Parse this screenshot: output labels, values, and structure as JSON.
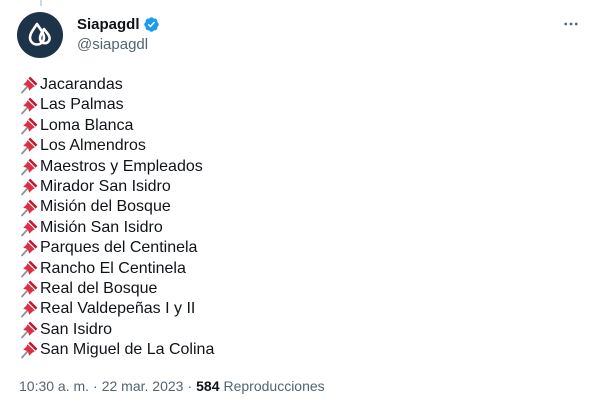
{
  "tweet": {
    "author": {
      "display_name": "Siapagdl",
      "handle": "@siapagdl",
      "avatar_icon": "water-drops-logo",
      "avatar_bg": "#1c3349",
      "verified": true,
      "verified_color": "#1d9bf0"
    },
    "more_icon": "more-horizontal-icon",
    "item_icon": "pushpin-emoji",
    "items": [
      "Jacarandas",
      "Las Palmas",
      "Loma Blanca",
      "Los Almendros",
      "Maestros y Empleados",
      "Mirador San Isidro",
      "Misión del Bosque",
      "Misión San Isidro",
      "Parques del Centinela",
      "Rancho El Centinela",
      "Real del Bosque",
      "Real Valdepeñas I y II",
      "San Isidro",
      "San Miguel de La Colina"
    ],
    "meta": {
      "time": "10:30 a. m.",
      "separator": "·",
      "date": "22 mar. 2023",
      "views_count": "584",
      "views_label": "Reproducciones"
    }
  }
}
